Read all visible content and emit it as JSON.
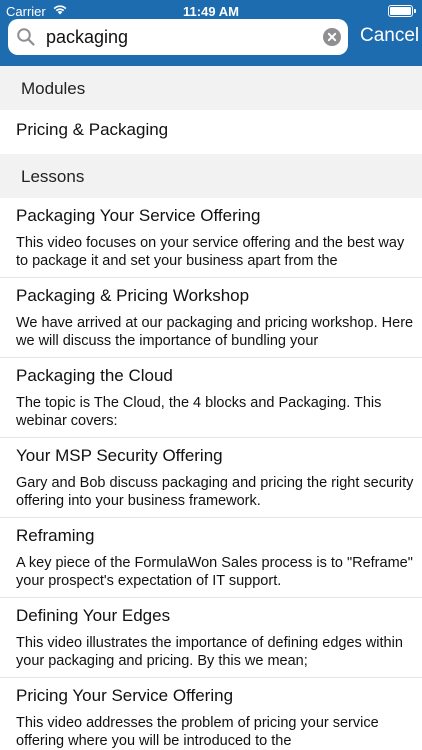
{
  "status_bar": {
    "carrier": "Carrier",
    "time": "11:49 AM"
  },
  "search": {
    "value": "packaging",
    "cancel_label": "Cancel"
  },
  "sections": {
    "modules": "Modules",
    "lessons": "Lessons"
  },
  "modules": [
    {
      "title": "Pricing & Packaging"
    }
  ],
  "lessons": [
    {
      "title": "Packaging Your Service Offering",
      "description": "This video focuses on your service offering and the best way to package it and set your business apart from the"
    },
    {
      "title": "Packaging & Pricing Workshop",
      "description": "We have arrived at our packaging and pricing workshop. Here we will discuss the importance of bundling your"
    },
    {
      "title": "Packaging the Cloud",
      "description": "The topic is The Cloud, the 4 blocks and Packaging.  This webinar covers:"
    },
    {
      "title": "Your MSP Security Offering",
      "description": "Gary and Bob discuss packaging and pricing the right security offering into your business framework."
    },
    {
      "title": "Reframing",
      "description": "A key piece of the FormulaWon Sales process is to \"Reframe\" your prospect's expectation of IT support."
    },
    {
      "title": "Defining Your Edges",
      "description": "This video illustrates the importance of defining edges within your packaging and pricing. By this we mean;"
    },
    {
      "title": "Pricing Your Service Offering",
      "description": "This video addresses the problem of pricing your service offering where you will be introduced to the"
    }
  ]
}
